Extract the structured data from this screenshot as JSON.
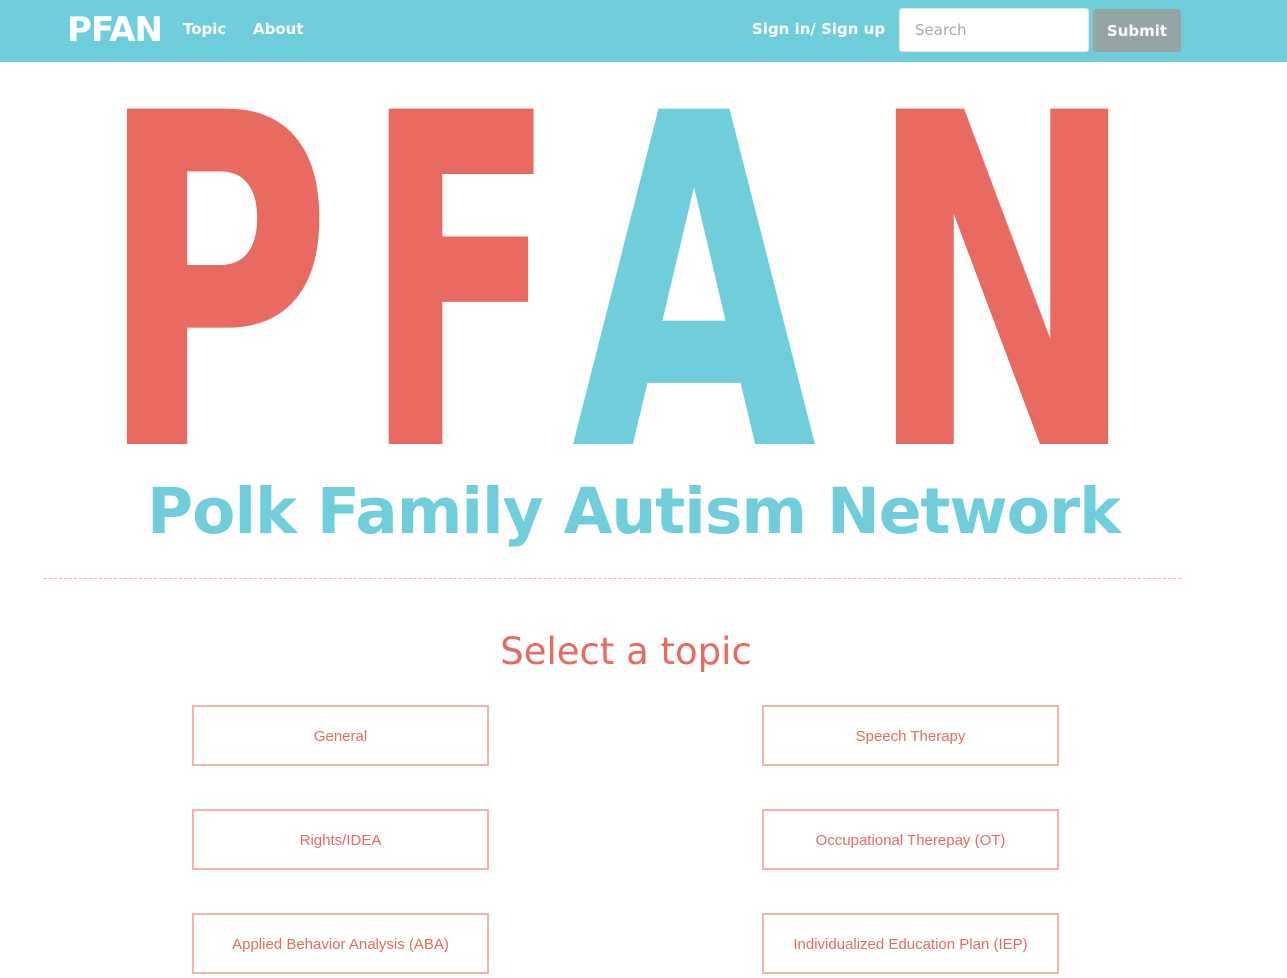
{
  "navbar": {
    "brand": "PFAN",
    "links": [
      {
        "label": "Topic"
      },
      {
        "label": "About"
      }
    ],
    "signin_label": "Sign in/ Sign up",
    "search_placeholder": "Search",
    "submit_label": "Submit"
  },
  "hero": {
    "logo_letters": [
      "P",
      "F",
      "A",
      "N"
    ],
    "tagline": "Polk Family Autism Network"
  },
  "topics_section": {
    "title": "Select a topic",
    "topics": [
      {
        "label": "General"
      },
      {
        "label": "Speech Therapy"
      },
      {
        "label": "Rights/IDEA"
      },
      {
        "label": "Occupational Therepay (OT)"
      },
      {
        "label": "Applied Behavior Analysis (ABA)"
      },
      {
        "label": "Individualized Education Plan (IEP)"
      }
    ]
  },
  "colors": {
    "navbar_bg": "#70cedc",
    "accent_red": "#e96a60",
    "accent_blue": "#70cedc",
    "button_border": "#f2b4ad",
    "submit_bg": "#95a5a6"
  }
}
